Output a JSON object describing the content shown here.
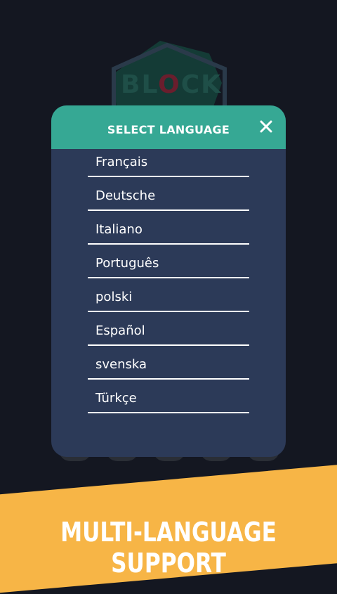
{
  "background_logo": {
    "text_a": "BL",
    "text_o": "O",
    "text_b": "CK"
  },
  "modal": {
    "title": "SELECT LANGUAGE",
    "close_icon": "close-icon",
    "languages": [
      "Français",
      "Deutsche",
      "Italiano",
      "Português",
      "polski",
      "Español",
      "svenska",
      "Türkçe"
    ]
  },
  "banner": {
    "text": "MULTI-LANGUAGE SUPPORT"
  },
  "colors": {
    "background": "#141721",
    "modal_header": "#36a894",
    "modal_body": "#2c3a58",
    "banner": "#f7b546"
  }
}
